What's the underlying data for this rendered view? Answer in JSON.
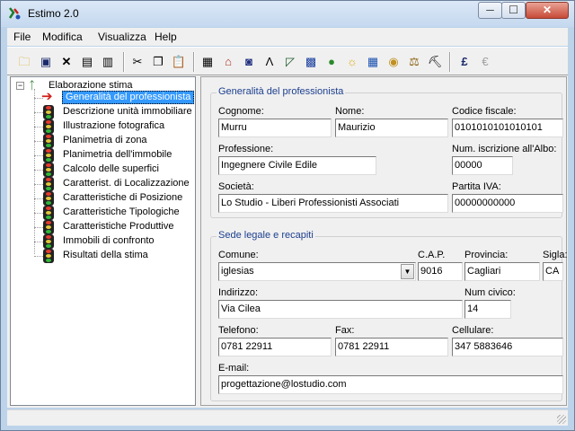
{
  "window": {
    "title": "Estimo 2.0",
    "min_glyph": "─",
    "max_glyph": "☐",
    "close_glyph": "✕"
  },
  "menu": [
    "File",
    "Modifica",
    "Visualizza",
    "Help"
  ],
  "toolbar": {
    "icons": [
      "open-folder-icon",
      "save-icon",
      "delete-icon",
      "save-as-icon",
      "save-all-icon",
      "cut-icon",
      "copy-icon",
      "paste-icon",
      "document-icon",
      "house-icon",
      "camera-icon",
      "compass-icon",
      "ruler-icon",
      "calculator-icon",
      "globe-icon",
      "sun-icon",
      "grid-icon",
      "coins-icon",
      "scales-icon",
      "builder-icon",
      "pound-icon",
      "euro-icon"
    ],
    "glyphs": {
      "pound": "£",
      "euro": "€"
    }
  },
  "tree": {
    "root_label": "Elaborazione stima",
    "expander": "−",
    "items": [
      "Generalità del professionista",
      "Descrizione unità immobiliare",
      "Illustrazione fotografica",
      "Planimetria di zona",
      "Planimetria dell'immobile",
      "Calcolo delle superfici",
      "Caratterist. di Localizzazione",
      "Caratteristiche di Posizione",
      "Caratteristiche Tipologiche",
      "Caratteristiche Produttive",
      "Immobili di confronto",
      "Risultati della stima"
    ],
    "selected_index": 0
  },
  "professionista": {
    "title": "Generalità del professionista",
    "cognome": {
      "label": "Cognome:",
      "value": "Murru"
    },
    "nome": {
      "label": "Nome:",
      "value": "Maurizio"
    },
    "codice_fiscale": {
      "label": "Codice fiscale:",
      "value": "0101010101010101"
    },
    "professione": {
      "label": "Professione:",
      "value": "Ingegnere Civile Edile"
    },
    "iscrizione": {
      "label": "Num. iscrizione all'Albo:",
      "value": "00000"
    },
    "societa": {
      "label": "Società:",
      "value": "Lo Studio - Liberi Professionisti Associati"
    },
    "partita_iva": {
      "label": "Partita IVA:",
      "value": "00000000000"
    }
  },
  "sede": {
    "title": "Sede legale e recapiti",
    "comune": {
      "label": "Comune:",
      "value": "iglesias"
    },
    "cap": {
      "label": "C.A.P.",
      "value": "9016"
    },
    "provincia": {
      "label": "Provincia:",
      "value": "Cagliari"
    },
    "sigla": {
      "label": "Sigla:",
      "value": "CA"
    },
    "indirizzo": {
      "label": "Indirizzo:",
      "value": "Via Cilea"
    },
    "civico": {
      "label": "Num civico:",
      "value": "14"
    },
    "telefono": {
      "label": "Telefono:",
      "value": "0781 22911"
    },
    "fax": {
      "label": "Fax:",
      "value": "0781 22911"
    },
    "cellulare": {
      "label": "Cellulare:",
      "value": "347 5883646"
    },
    "email": {
      "label": "E-mail:",
      "value": "progettazione@lostudio.com"
    }
  }
}
